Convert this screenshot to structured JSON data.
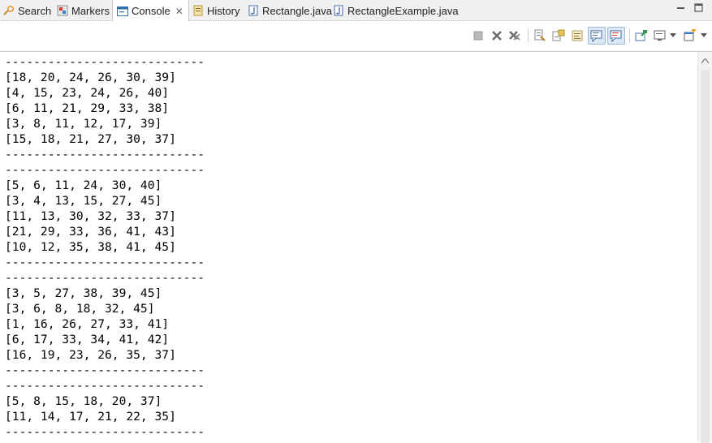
{
  "tabs": [
    {
      "label": "Search",
      "icon": "search-icon"
    },
    {
      "label": "Markers",
      "icon": "markers-icon"
    },
    {
      "label": "Console",
      "icon": "console-icon",
      "active": true
    },
    {
      "label": "History",
      "icon": "history-icon"
    },
    {
      "label": "Rectangle.java",
      "icon": "java-file-icon"
    },
    {
      "label": "RectangleExample.java",
      "icon": "java-file-icon"
    }
  ],
  "window_controls": {
    "minimize": "▭",
    "maximize": "□"
  },
  "console_close": "✕",
  "toolbar": {
    "terminate": "terminate-icon",
    "remove_launch": "remove-launch-icon",
    "remove_all": "remove-all-terminated-icon",
    "clear": "clear-console-icon",
    "scroll_lock": "scroll-lock-icon",
    "word_wrap": "word-wrap-icon",
    "show_on_stdout": "show-console-stdout-icon",
    "show_on_stderr": "show-console-stderr-icon",
    "pin": "pin-console-icon",
    "display_selected": "display-selected-console-icon",
    "open_console": "open-console-icon"
  },
  "console_lines": [
    "----------------------------",
    "[18, 20, 24, 26, 30, 39]",
    "[4, 15, 23, 24, 26, 40]",
    "[6, 11, 21, 29, 33, 38]",
    "[3, 8, 11, 12, 17, 39]",
    "[15, 18, 21, 27, 30, 37]",
    "----------------------------",
    "----------------------------",
    "[5, 6, 11, 24, 30, 40]",
    "[3, 4, 13, 15, 27, 45]",
    "[11, 13, 30, 32, 33, 37]",
    "[21, 29, 33, 36, 41, 43]",
    "[10, 12, 35, 38, 41, 45]",
    "----------------------------",
    "----------------------------",
    "[3, 5, 27, 38, 39, 45]",
    "[3, 6, 8, 18, 32, 45]",
    "[1, 16, 26, 27, 33, 41]",
    "[6, 17, 33, 34, 41, 42]",
    "[16, 19, 23, 26, 35, 37]",
    "----------------------------",
    "----------------------------",
    "[5, 8, 15, 18, 20, 37]",
    "[11, 14, 17, 21, 22, 35]",
    "----------------------------"
  ],
  "colors": {
    "accent": "#2f6fb3",
    "java_icon": "#4a6fa5",
    "text": "#000000"
  }
}
